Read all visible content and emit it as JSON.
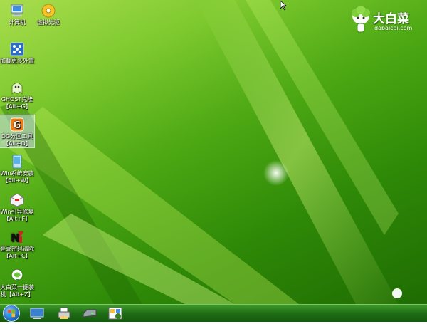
{
  "desktop": {
    "icons": [
      {
        "name": "computer-icon",
        "label": "计算机",
        "label2": ""
      },
      {
        "name": "virtual-disc-icon",
        "label": "虚拟光驱",
        "label2": ""
      },
      {
        "name": "load-device-icon",
        "label": "加载更多外置",
        "label2": ""
      },
      {
        "name": "ghost-icon",
        "label": "GHOST克隆",
        "label2": "【Alt+G】"
      },
      {
        "name": "diskgenius-icon",
        "label": "DG分区工具",
        "label2": "【Alt+D】"
      },
      {
        "name": "win-installer-icon",
        "label": "Win系统安装",
        "label2": "【Alt+W】"
      },
      {
        "name": "boot-repair-icon",
        "label": "Win引导修复",
        "label2": "【Alt+F】"
      },
      {
        "name": "password-clear-icon",
        "label": "登录密码清除",
        "label2": "【Alt+C】"
      },
      {
        "name": "one-key-install-icon",
        "label": "大白菜一键装",
        "label2": "机【Alt+Z】"
      }
    ]
  },
  "brand": {
    "name": "大白菜",
    "domain": "dabaicai.com"
  },
  "taskbar": {
    "items": [
      "network-icon",
      "printer-icon",
      "drive-icon",
      "tools-icon"
    ]
  },
  "colors": {
    "taskbar": "#1f6d15",
    "desktop": "#4ea914",
    "start": "#1a5fb4"
  }
}
